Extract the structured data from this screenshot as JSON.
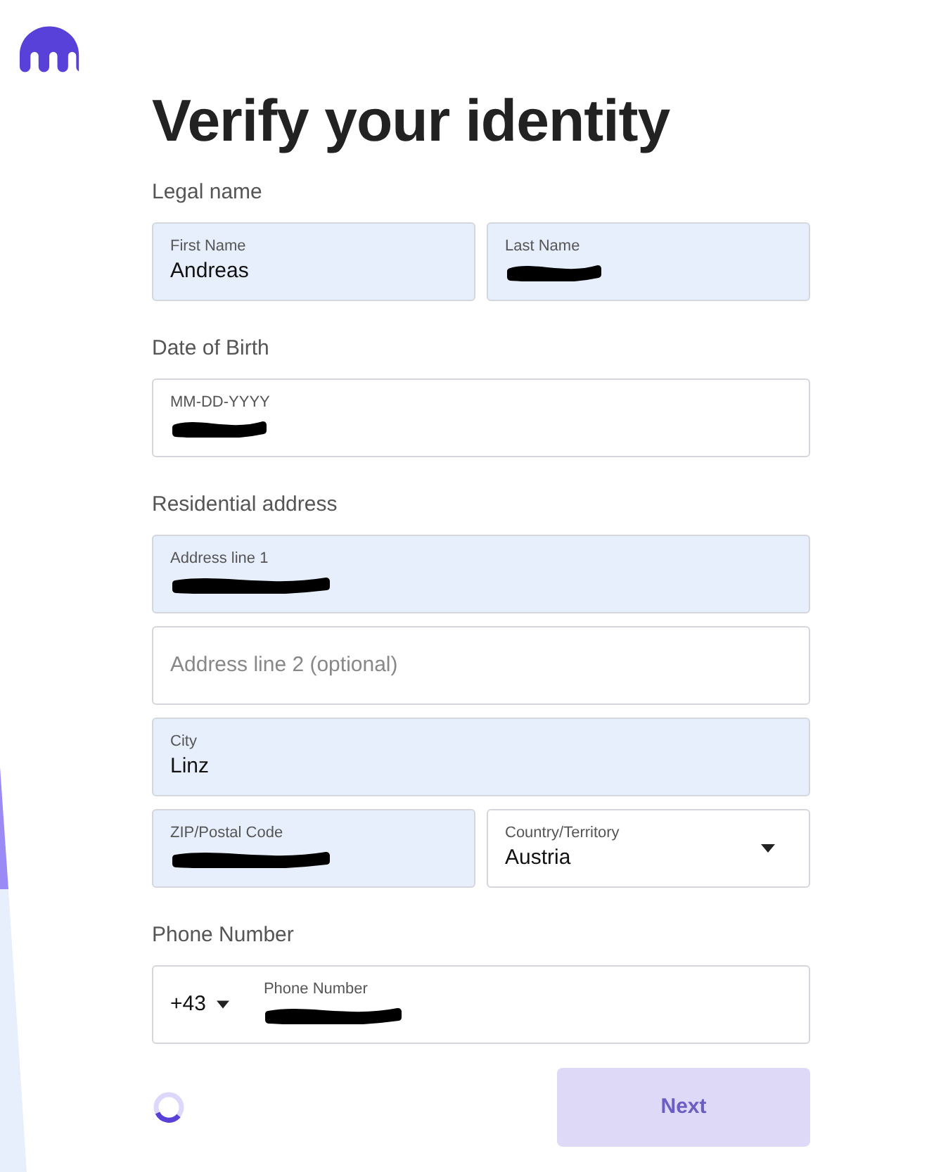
{
  "title": "Verify your identity",
  "sections": [
    {
      "label": "Legal name",
      "rows": [
        [
          {
            "kind": "text",
            "label": "First Name",
            "value": "Andreas",
            "filled": true,
            "redacted": false
          },
          {
            "kind": "text",
            "label": "Last Name",
            "filled": true,
            "redacted": true
          }
        ]
      ]
    },
    {
      "label": "Date of Birth",
      "rows": [
        [
          {
            "kind": "text",
            "label": "MM-DD-YYYY",
            "filled": false,
            "redacted": true
          }
        ]
      ]
    },
    {
      "label": "Residential address",
      "rows": [
        [
          {
            "kind": "text",
            "label": "Address line 1",
            "filled": true,
            "redacted": true
          }
        ],
        [
          {
            "kind": "text",
            "placeholder": "Address line 2 (optional)",
            "filled": false,
            "redacted": false
          }
        ],
        [
          {
            "kind": "text",
            "label": "City",
            "value": "Linz",
            "filled": true,
            "redacted": false
          }
        ],
        [
          {
            "kind": "text",
            "label": "ZIP/Postal Code",
            "filled": true,
            "redacted": true
          },
          {
            "kind": "select",
            "label": "Country/Territory",
            "value": "Austria",
            "filled": false,
            "redacted": false
          }
        ]
      ]
    },
    {
      "label": "Phone Number",
      "rows": [
        [
          {
            "kind": "phone",
            "code": "+43",
            "label": "Phone Number",
            "filled": false,
            "redacted": true
          }
        ]
      ]
    }
  ],
  "loading": true,
  "next_button": {
    "label": "Next",
    "disabled": true
  }
}
